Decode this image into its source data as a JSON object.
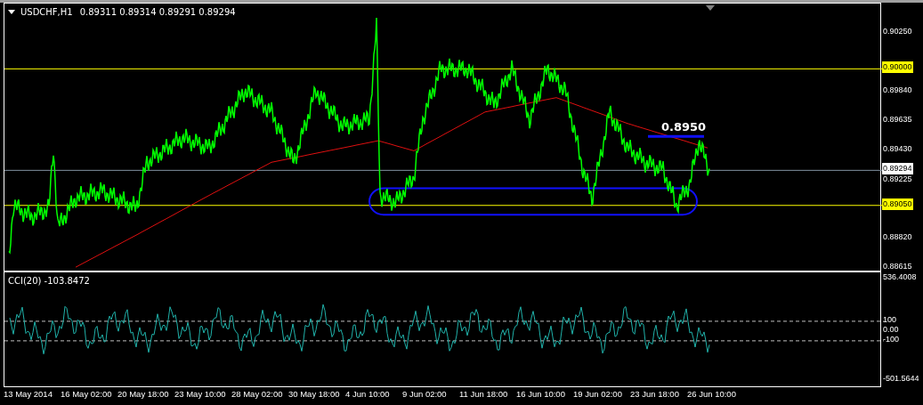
{
  "chart": {
    "symbol": "USDCHF,H1",
    "ohlc": "0.89311 0.89314 0.89291 0.89294",
    "annotation": "0.8950"
  },
  "price_axis": {
    "ticks": [
      "0.90250",
      "0.89840",
      "0.89635",
      "0.89430",
      "0.89225",
      "0.88820",
      "0.88615"
    ],
    "lines": [
      {
        "label": "0.90000",
        "kind": "level"
      },
      {
        "label": "0.89294",
        "kind": "bid"
      },
      {
        "label": "0.89050",
        "kind": "level"
      }
    ]
  },
  "indicator": {
    "title": "CCI(20) -103.8472",
    "max": "536.4008",
    "levels": [
      "100",
      "0.00",
      "-100"
    ],
    "min": "-501.5644"
  },
  "time_axis": [
    "13 May 2014",
    "16 May 02:00",
    "20 May 18:00",
    "23 May 10:00",
    "28 May 02:00",
    "30 May 18:00",
    "4 Jun 10:00",
    "9 Jun 02:00",
    "11 Jun 18:00",
    "16 Jun 10:00",
    "19 Jun 02:00",
    "23 Jun 18:00",
    "26 Jun 10:00"
  ]
}
